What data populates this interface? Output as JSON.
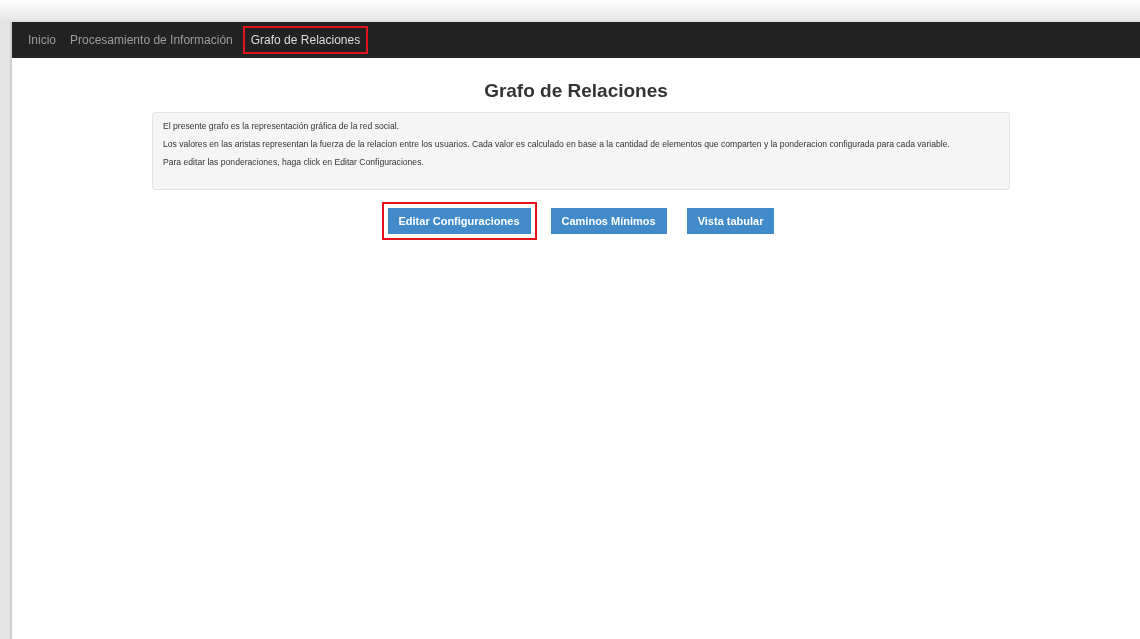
{
  "nav": {
    "items": [
      {
        "label": "Inicio",
        "selected": false,
        "highlighted": false
      },
      {
        "label": "Procesamiento de Información",
        "selected": false,
        "highlighted": false
      },
      {
        "label": "Grafo de Relaciones",
        "selected": true,
        "highlighted": true
      }
    ]
  },
  "title": "Grafo de Relaciones",
  "info": {
    "paragraphs": [
      "El presente grafo es la representación gráfica de la red social.",
      "Los valores en las aristas representan la fuerza de la relacion entre los usuarios. Cada valor es calculado en base a la cantidad de elementos que comparten y la ponderacion configurada para cada variable.",
      "Para editar las ponderaciones, haga click en Editar Configuraciones."
    ]
  },
  "buttons": [
    {
      "label": "Editar Configuraciones",
      "highlighted": true
    },
    {
      "label": "Caminos Mínimos",
      "highlighted": false
    },
    {
      "label": "Vista tabular",
      "highlighted": false
    }
  ]
}
